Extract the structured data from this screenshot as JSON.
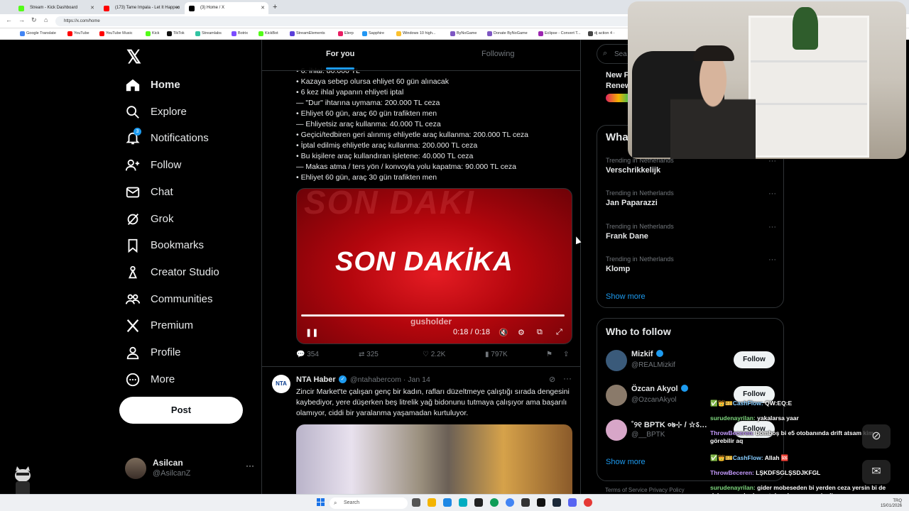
{
  "browser": {
    "tabs": [
      {
        "label": "Stream - Kick Dashboard",
        "color": "#53fc18"
      },
      {
        "label": "(173) Tame Impala - Let It Happen",
        "color": "#ff0000"
      },
      {
        "label": "(3) Home / X",
        "color": "#000000"
      }
    ],
    "url": "https://x.com/home",
    "bookmarks": [
      "Google Translate",
      "YouTube",
      "YouTube Music",
      "Kick",
      "TikTok",
      "Streamlabs",
      "Botrix",
      "KickBot",
      "StreamElements",
      "Elerp",
      "Sapphire",
      "Windows 10 high...",
      "ByNoGame",
      "Donate ByNoGame",
      "Eclipse - Convert T...",
      "dj action 4 -"
    ]
  },
  "nav": {
    "items": [
      {
        "label": "Home",
        "icon": "home-icon"
      },
      {
        "label": "Explore",
        "icon": "search-icon"
      },
      {
        "label": "Notifications",
        "icon": "bell-icon",
        "badge": "3"
      },
      {
        "label": "Follow",
        "icon": "person-add-icon"
      },
      {
        "label": "Chat",
        "icon": "mail-icon"
      },
      {
        "label": "Grok",
        "icon": "grok-icon"
      },
      {
        "label": "Bookmarks",
        "icon": "bookmark-icon"
      },
      {
        "label": "Creator Studio",
        "icon": "creator-studio-icon"
      },
      {
        "label": "Communities",
        "icon": "communities-icon"
      },
      {
        "label": "Premium",
        "icon": "x-logo-icon"
      },
      {
        "label": "Profile",
        "icon": "profile-icon"
      },
      {
        "label": "More",
        "icon": "more-circle-icon"
      }
    ],
    "post_label": "Post",
    "account": {
      "name": "Asilcan",
      "handle": "@AsilcanZ",
      "more": "···"
    }
  },
  "feed": {
    "tabs": {
      "for_you": "For you",
      "following": "Following"
    },
    "tweet1": {
      "lines": [
        "• 6. ihlal: 80.000 TL",
        "• Kazaya sebep olursa ehliyet 60 gün alınacak",
        "• 6 kez ihlal yapanın ehliyeti iptal",
        "— \"Dur\" ihtarına uymama: 200.000 TL ceza",
        "• Ehliyet 60 gün, araç 60 gün trafikten men",
        "—  Ehliyetsiz araç kullanma: 40.000 TL ceza",
        "• Geçici/tedbiren geri alınmış ehliyetle araç kullanma: 200.000 TL ceza",
        "• İptal edilmiş ehliyetle araç kullanma: 200.000 TL ceza",
        "• Bu kişilere araç kullandıran işletene: 40.000 TL ceza",
        "—  Makas atma / ters yön / konvoyla yolu kapatma: 90.000 TL ceza",
        "• Ehliyet 60 gün, araç 30 gün trafikten men"
      ],
      "media": {
        "title": "SON DAKİKA",
        "ghost": "SON DAKİ",
        "watermark": "gusholder",
        "time": "0:18 / 0:18",
        "progress": 1.0
      },
      "stats": {
        "replies": "354",
        "reposts": "325",
        "likes": "2.2K",
        "views": "797K"
      }
    },
    "tweet2": {
      "avatar_text": "NTA",
      "name": "NTA Haber",
      "handle_date": "@ntahabercom · Jan 14",
      "text": "Zincir Market'te çalışan genç bir kadın, rafları düzeltmeye çalıştığı sırada dengesini kaybediyor, yere düşerken beş litrelik yağ bidonunu tutmaya çalışıyor ama başarılı olamıyor, ciddi bir yaralanma yaşamadan kurtuluyor."
    }
  },
  "right": {
    "search_placeholder": "Sea",
    "premium": {
      "line1": "New F",
      "line2": "Renew"
    },
    "trends_title": "What",
    "trends": [
      {
        "context": "Trending in Netherlands",
        "name": "Verschrikkelijk"
      },
      {
        "context": "Trending in Netherlands",
        "name": "Jan Paparazzi"
      },
      {
        "context": "Trending in Netherlands",
        "name": "Frank Dane"
      },
      {
        "context": "Trending in Netherlands",
        "name": "Klomp"
      }
    ],
    "show_more": "Show more",
    "wtf_title": "Who to follow",
    "people": [
      {
        "name": "Mizkif",
        "handle": "@REALMizkif",
        "follow": "Follow",
        "color": "#3a5a7a"
      },
      {
        "name": "Özcan Akyol",
        "handle": "@OzcanAkyol",
        "follow": "Follow",
        "color": "#8a7a6a"
      },
      {
        "name": "˚୨୧ BPTK ०७⊹ / ☆ऽ…",
        "handle": "@__BPTK",
        "follow": "Follow",
        "color": "#d7a6c8"
      }
    ],
    "wtf_show_more": "Show more",
    "footer": "Terms of Service   Privacy Policy"
  },
  "chat": [
    {
      "user": "✅👑🎫CashFlow:",
      "msg": " QW:EQ:E",
      "cls": ""
    },
    {
      "user": "surudenayrilan:",
      "msg": " yakalarsa yaar",
      "cls": "g"
    },
    {
      "user": "ThrowBeceren:",
      "msg": " bomboş bi e5 otobanında drift atsam kim görebilir aq",
      "cls": "p"
    },
    {
      "user": "✅👑🎫CashFlow:",
      "msg": " Allah 🆘",
      "cls": ""
    },
    {
      "user": "ThrowBeceren:",
      "msg": " LŞKDFSGLŞSDJKFGL",
      "cls": "p"
    },
    {
      "user": "surudenayrilan:",
      "msg": " gider mobeseden bi yerden ceza yersin bi de dalga geçerler boş otobanda ceza yemiş diye",
      "cls": "g"
    }
  ],
  "taskbar": {
    "search": "Search",
    "tray_lang": "TRQ",
    "tray_time": "15/01/2026"
  }
}
